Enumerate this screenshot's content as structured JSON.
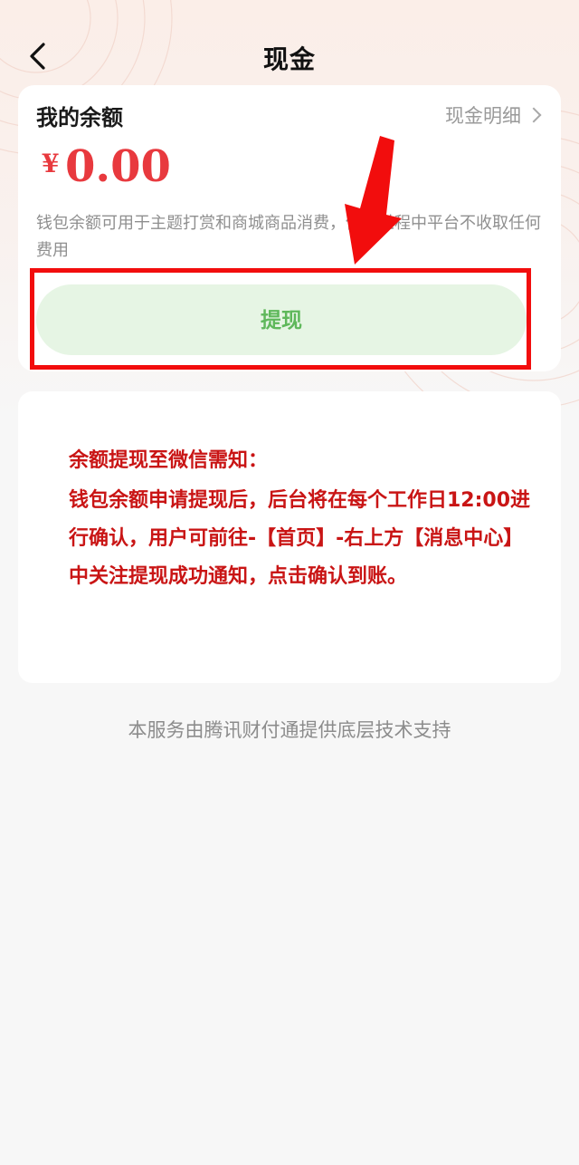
{
  "header": {
    "title": "现金",
    "back_icon": "chevron-left-icon"
  },
  "balance": {
    "title": "我的余额",
    "detail_link": "现金明细",
    "currency": "¥",
    "amount": "0.00",
    "description": "钱包余额可用于主题打赏和商城商品消费，使用过程中平台不收取任何费用",
    "withdraw_label": "提现"
  },
  "notice": {
    "title": "余额提现至微信需知：",
    "body": "钱包余额申请提现后，后台将在每个工作日12:00进行确认，用户可前往-【首页】-右上方【消息中心】中关注提现成功通知，点击确认到账。"
  },
  "footer": {
    "note": "本服务由腾讯财付通提供底层技术支持"
  },
  "colors": {
    "accent_red": "#e8393e",
    "notice_red": "#c91515",
    "button_green_bg": "#e6f5e4",
    "button_green_text": "#5fb85b",
    "annotation_red": "#f20d0d"
  }
}
